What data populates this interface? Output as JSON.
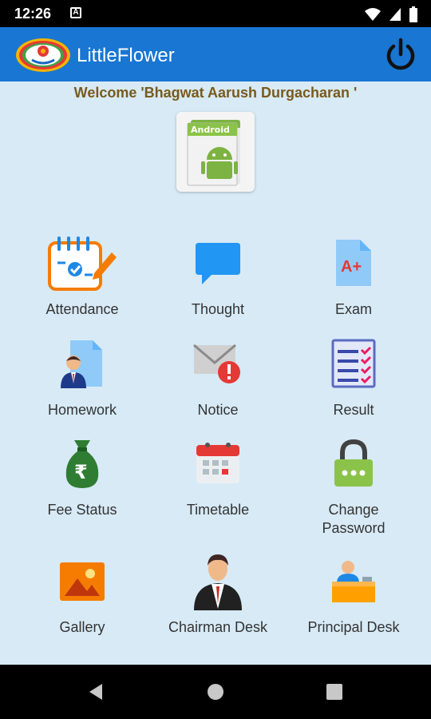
{
  "status_bar": {
    "time": "12:26",
    "notification_letter": "A"
  },
  "app_bar": {
    "title": "LittleFlower"
  },
  "welcome": {
    "text": "Welcome  'Bhagwat Aarush Durgacharan '"
  },
  "avatar_label": "Android",
  "menu": {
    "attendance": "Attendance",
    "thought": "Thought",
    "exam": "Exam",
    "homework": "Homework",
    "notice": "Notice",
    "result": "Result",
    "fee_status": "Fee Status",
    "timetable": "Timetable",
    "change_password_line1": "Change",
    "change_password_line2": "Password",
    "gallery": "Gallery",
    "chairman_desk": "Chairman Desk",
    "principal_desk": "Principal Desk"
  },
  "exam_icon_text": "A+",
  "fee_icon_text": "₹",
  "colors": {
    "app_bar": "#1976D2",
    "background": "#d7eaf6",
    "welcome_text": "#7a5a1c"
  }
}
